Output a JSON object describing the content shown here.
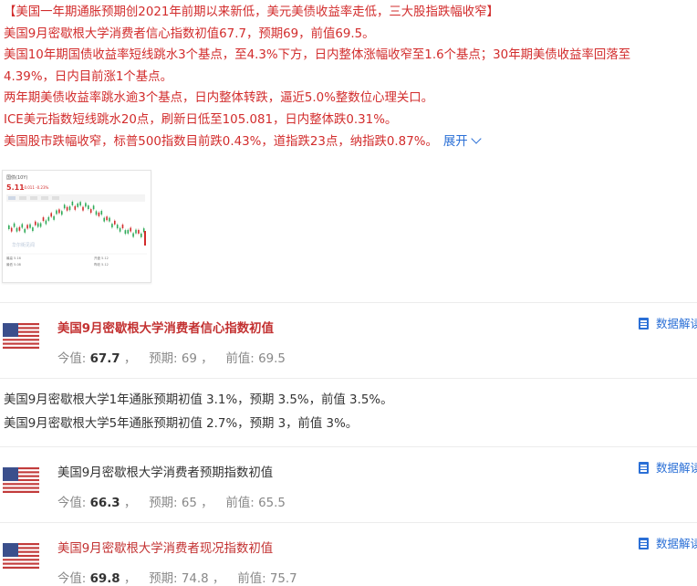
{
  "news": {
    "headline": "【美国一年期通胀预期创2021年前期以来新低，美元美债收益率走低，三大股指跌幅收窄】",
    "lines": [
      "美国9月密歇根大学消费者信心指数初值67.7，预期69，前值69.5。",
      "美国10年期国债收益率短线跳水3个基点，至4.3%下方，日内整体涨幅收窄至1.6个基点；30年期美债收益率回落至",
      "4.39%，日内目前涨1个基点。",
      "两年期美债收益率跳水逾3个基点，日内整体转跌，逼近5.0%整数位心理关口。",
      "ICE美元指数短线跳水20点，刷新日低至105.081，日内整体跌0.31%。",
      "美国股市跌幅收窄，标普500指数目前跌0.43%，道指跌23点，纳指跌0.87%。"
    ],
    "expand_label": "展开",
    "expand_icon": "chevron-down-icon",
    "accent_color": "#d22c2c",
    "link_color": "#2a6fd6"
  },
  "thumbnail": {
    "label": "国债(10Y)",
    "price": "5.11",
    "change": "-0.011 -0.23%",
    "watermark": "华尔街见闻",
    "footer_left": [
      "最高 5.16",
      "最低 5.08"
    ],
    "footer_right": [
      "开盘 5.12",
      "昨收 5.12"
    ]
  },
  "cards": [
    {
      "title": "美国9月密歇根大学消费者信心指数初值",
      "current_label": "今值:",
      "current": "67.7",
      "forecast_label": "预期:",
      "forecast": "69",
      "previous_label": "前值:",
      "previous": "69.5",
      "link": "数据解读",
      "flag": "us-flag-icon"
    },
    {
      "title": "美国9月密歇根大学消费者预期指数初值",
      "current_label": "今值:",
      "current": "66.3",
      "forecast_label": "预期:",
      "forecast": "65",
      "previous_label": "前值:",
      "previous": "65.5",
      "link": "数据解读",
      "flag": "us-flag-icon"
    },
    {
      "title": "美国9月密歇根大学消费者现况指数初值",
      "current_label": "今值:",
      "current": "69.8",
      "forecast_label": "预期:",
      "forecast": "74.8",
      "previous_label": "前值:",
      "previous": "75.7",
      "link": "数据解读",
      "flag": "us-flag-icon"
    }
  ],
  "inflation": [
    "美国9月密歇根大学1年通胀预期初值 3.1%，预期 3.5%，前值 3.5%。",
    "美国9月密歇根大学5年通胀预期初值 2.7%，预期 3，前值 3%。"
  ]
}
